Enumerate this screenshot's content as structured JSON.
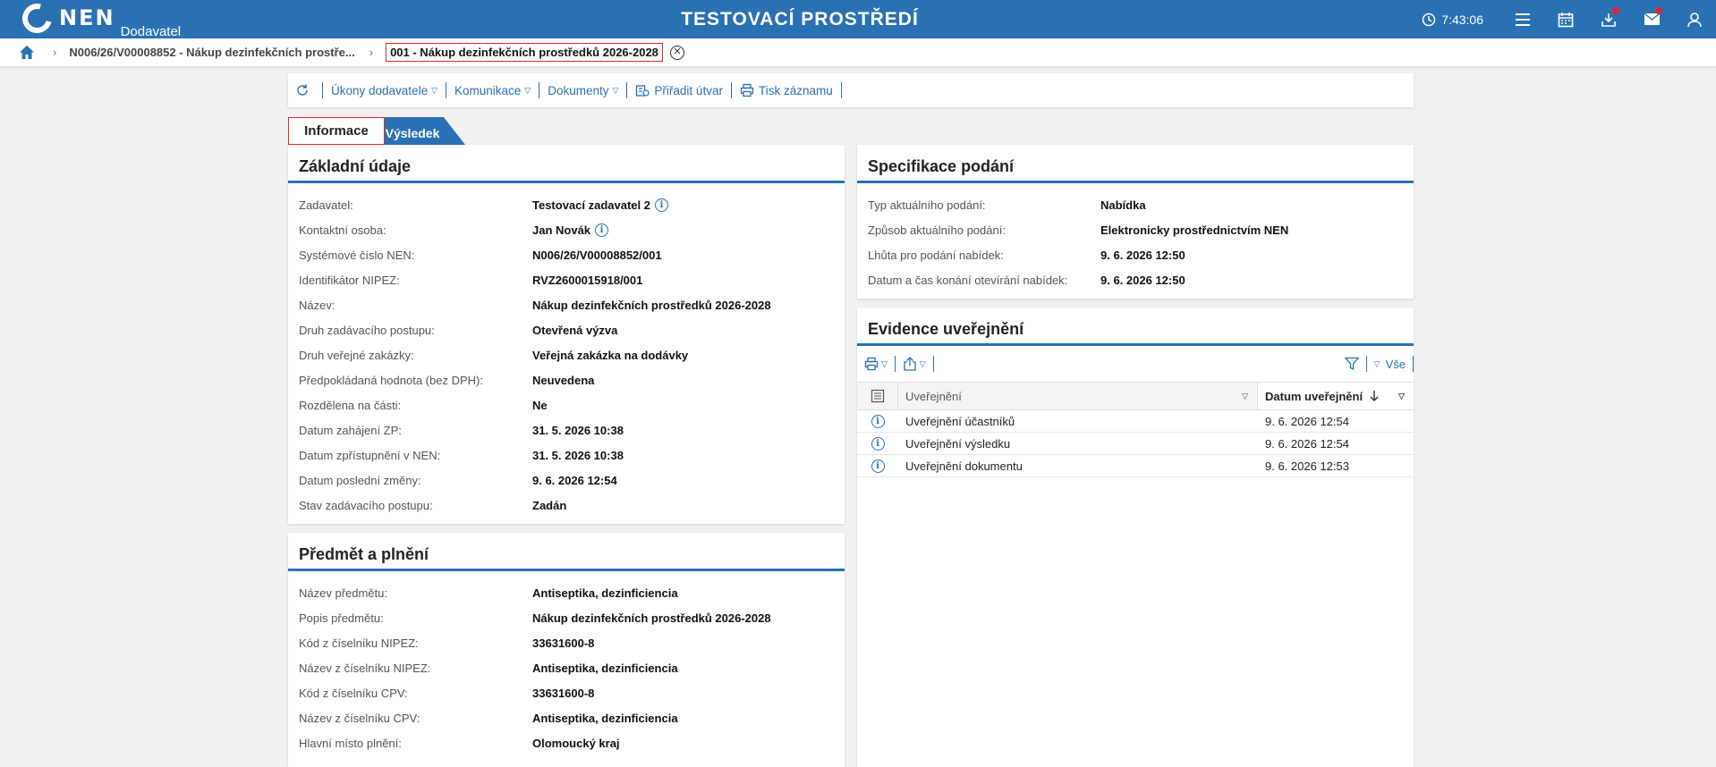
{
  "header": {
    "logo_text": "NEN",
    "logo_sub": "Dodavatel",
    "env_title": "TESTOVACÍ PROSTŘEDÍ",
    "clock": "7:43:06",
    "accent": "#2a71b3",
    "notify_color": "#e0262d"
  },
  "breadcrumb": {
    "item1": "N006/26/V00008852 - Nákup dezinfekčních prostře...",
    "current": "001 - Nákup dezinfekčních prostředků 2026-2028"
  },
  "toolbar": {
    "ukony": "Úkony dodavatele",
    "komunikace": "Komunikace",
    "dokumenty": "Dokumenty",
    "priradit": "Přiřadit útvar",
    "tisk": "Tisk záznamu"
  },
  "tabs": {
    "informace": "Informace",
    "vysledek": "Výsledek"
  },
  "zakladni": {
    "title": "Základní údaje",
    "rows": [
      {
        "label": "Zadavatel:",
        "value": "Testovací zadavatel 2"
      },
      {
        "label": "Kontaktní osoba:",
        "value": "Jan Novák"
      },
      {
        "label": "Systémové číslo NEN:",
        "value": "N006/26/V00008852/001"
      },
      {
        "label": "Identifikátor NIPEZ:",
        "value": "RVZ2600015918/001"
      },
      {
        "label": "Název:",
        "value": "Nákup dezinfekčních prostředků 2026-2028"
      },
      {
        "label": "Druh zadávacího postupu:",
        "value": "Otevřená výzva"
      },
      {
        "label": "Druh veřejné zakázky:",
        "value": "Veřejná zakázka na dodávky"
      },
      {
        "label": "Předpokládaná hodnota (bez DPH):",
        "value": "Neuvedena"
      },
      {
        "label": "Rozdělena na části:",
        "value": "Ne"
      },
      {
        "label": "Datum zahájení ZP:",
        "value": "31. 5. 2026 10:38"
      },
      {
        "label": "Datum zpřístupnění v NEN:",
        "value": "31. 5. 2026 10:38"
      },
      {
        "label": "Datum poslední změny:",
        "value": "9. 6. 2026 12:54"
      },
      {
        "label": "Stav zadávacího postupu:",
        "value": "Zadán"
      }
    ]
  },
  "predmet": {
    "title": "Předmět a plnění",
    "rows": [
      {
        "label": "Název předmětu:",
        "value": "Antiseptika, dezinficiencia"
      },
      {
        "label": "Popis předmětu:",
        "value": "Nákup dezinfekčních prostředků 2026-2028"
      },
      {
        "label": "Kód z číselníku NIPEZ:",
        "value": "33631600-8"
      },
      {
        "label": "Název z číselníku NIPEZ:",
        "value": "Antiseptika, dezinficiencia"
      },
      {
        "label": "Kód z číselníku CPV:",
        "value": "33631600-8"
      },
      {
        "label": "Název z číselníku CPV:",
        "value": "Antiseptika, dezinficiencia"
      },
      {
        "label": "Hlavní místo plnění:",
        "value": "Olomoucký kraj"
      }
    ]
  },
  "specifikace": {
    "title": "Specifikace podání",
    "rows": [
      {
        "label": "Typ aktuálního podání:",
        "value": "Nabídka"
      },
      {
        "label": "Způsob aktuálního podání:",
        "value": "Elektronicky prostřednictvím NEN"
      },
      {
        "label": "Lhůta pro podání nabídek:",
        "value": "9. 6. 2026 12:50"
      },
      {
        "label": "Datum a čas konání otevírání nabídek:",
        "value": "9. 6. 2026 12:50"
      }
    ]
  },
  "evidence": {
    "title": "Evidence uveřejnění",
    "filter_all": "Vše",
    "col1": "Uveřejnění",
    "col2": "Datum uveřejnění",
    "rows": [
      {
        "name": "Uveřejnění účastníků",
        "date": "9. 6. 2026 12:54"
      },
      {
        "name": "Uveřejnění výsledku",
        "date": "9. 6. 2026 12:54"
      },
      {
        "name": "Uveřejnění dokumentu",
        "date": "9. 6. 2026 12:53"
      }
    ]
  }
}
